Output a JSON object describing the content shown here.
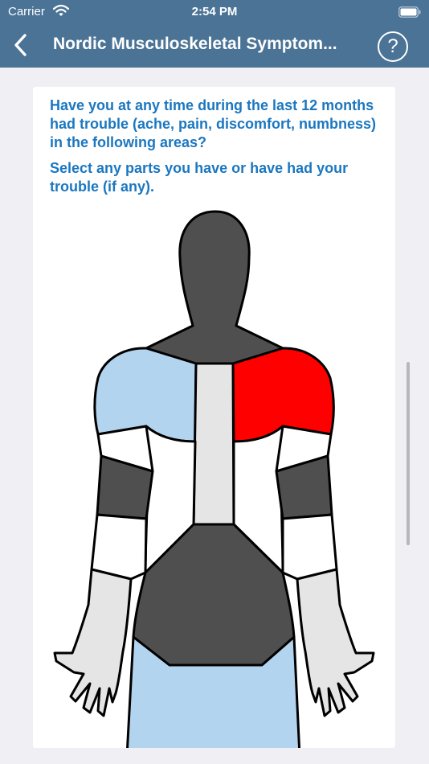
{
  "status_bar": {
    "carrier": "Carrier",
    "time": "2:54 PM",
    "wifi_icon": "wifi-icon",
    "battery_icon": "battery-icon"
  },
  "nav": {
    "title": "Nordic Musculoskeletal Symptom...",
    "back_icon": "chevron-left-icon",
    "help_label": "?"
  },
  "question": {
    "line1": "Have you at any time during the last 12 months had trouble (ache, pain, discomfort, numbness) in the following areas?",
    "line2": "Select any parts you have or have had your trouble (if any)."
  },
  "body_map": {
    "colors": {
      "selected": "#ff0000",
      "highlighted": "#b3d4ef",
      "dark": "#4f4f4f",
      "light": "#e5e5e5",
      "white": "#ffffff",
      "outline": "#000000",
      "legs": "#b3d4ef"
    },
    "parts": [
      {
        "id": "neck",
        "state": "dark"
      },
      {
        "id": "right-shoulder",
        "state": "highlighted"
      },
      {
        "id": "left-shoulder",
        "state": "selected"
      },
      {
        "id": "upper-back",
        "state": "light"
      },
      {
        "id": "lower-back",
        "state": "dark"
      },
      {
        "id": "elbows",
        "state": "dark"
      },
      {
        "id": "wrists-hands",
        "state": "light"
      },
      {
        "id": "hips-thighs",
        "state": "highlighted"
      }
    ]
  }
}
